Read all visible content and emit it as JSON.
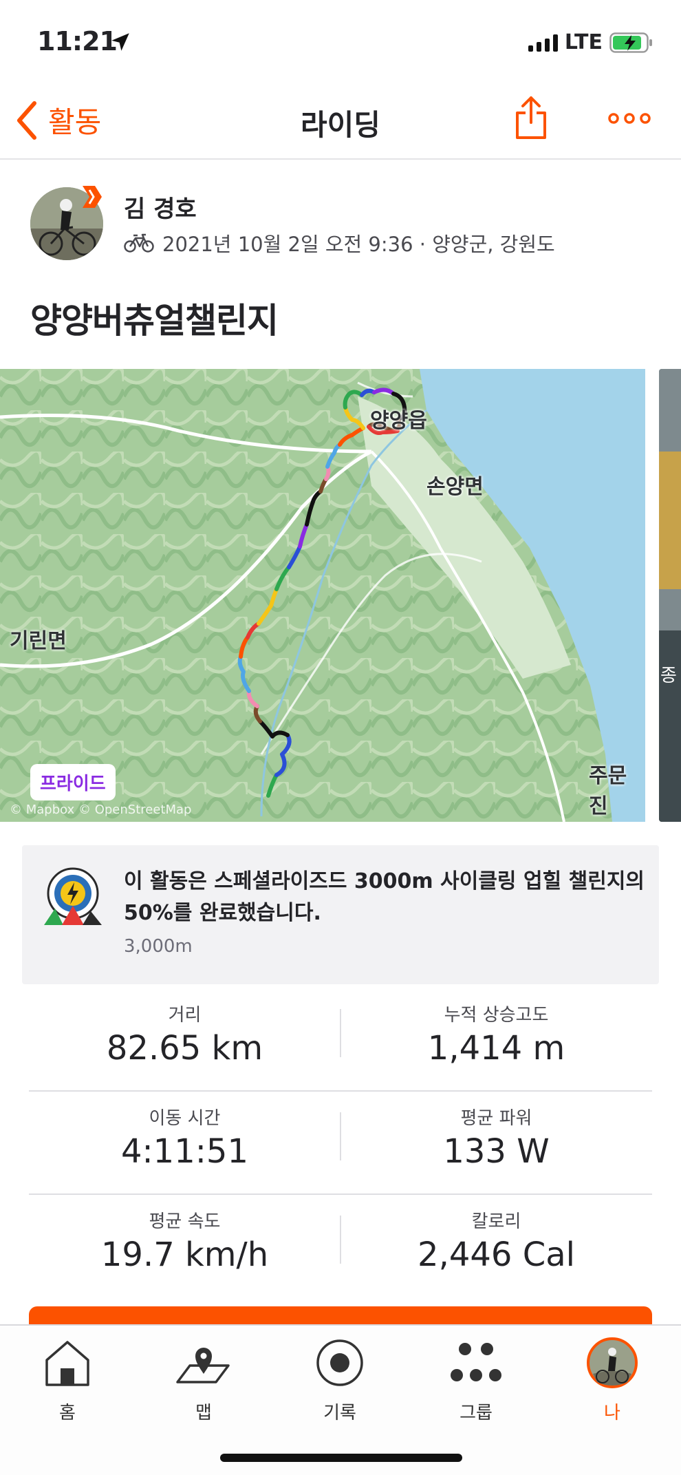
{
  "status_bar": {
    "time": "11:21",
    "network": "LTE"
  },
  "nav": {
    "back_label": "활동",
    "title": "라이딩"
  },
  "athlete": {
    "name": "김 경호"
  },
  "activity": {
    "meta": "2021년 10월 2일 오전 9:36 · 양양군, 강원도",
    "title": "양양버츄얼챌린지"
  },
  "map": {
    "labels": {
      "yangyang": "양양읍",
      "sonyang": "손양면",
      "girin": "기린면",
      "jumunjin": "주문진"
    },
    "tag": "프라이드",
    "attribution": "© Mapbox © OpenStreetMap",
    "peek_text": "종"
  },
  "challenge": {
    "text": "이 활동은 스페셜라이즈드 3000m 사이클링 업힐 챌린지의 50%를 완료했습니다.",
    "goal": "3,000m",
    "progress_fraction": 0.5
  },
  "stats": [
    {
      "label": "거리",
      "value": "82.65 km"
    },
    {
      "label": "누적 상승고도",
      "value": "1,414 m"
    },
    {
      "label": "이동 시간",
      "value": "4:11:51"
    },
    {
      "label": "평균 파워",
      "value": "133 W"
    },
    {
      "label": "평균 속도",
      "value": "19.7 km/h"
    },
    {
      "label": "칼로리",
      "value": "2,446 Cal"
    }
  ],
  "tabs": [
    {
      "label": "홈",
      "icon": "home-icon"
    },
    {
      "label": "맵",
      "icon": "map-icon"
    },
    {
      "label": "기록",
      "icon": "record-icon"
    },
    {
      "label": "그룹",
      "icon": "groups-icon"
    },
    {
      "label": "나",
      "icon": "profile-avatar",
      "active": true
    }
  ],
  "colors": {
    "accent": "#fc5200",
    "text": "#242428",
    "tag_text": "#8a2be2"
  }
}
